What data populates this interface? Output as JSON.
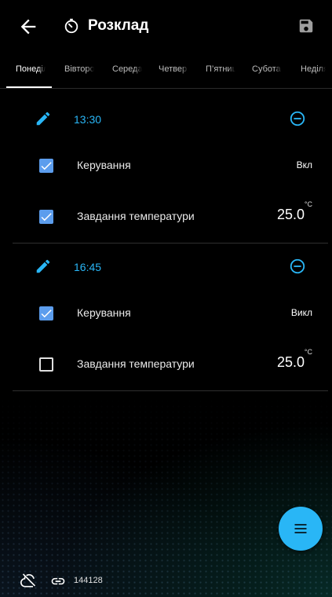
{
  "header": {
    "title": "Розклад"
  },
  "tabs": [
    {
      "label": "Понеділок",
      "active": true
    },
    {
      "label": "Вівторок",
      "active": false
    },
    {
      "label": "Середа",
      "active": false
    },
    {
      "label": "Четвер",
      "active": false
    },
    {
      "label": "П’ятниця",
      "active": false
    },
    {
      "label": "Субота",
      "active": false
    },
    {
      "label": "Неділя",
      "active": false
    }
  ],
  "schedules": [
    {
      "time": "13:30",
      "rows": [
        {
          "label": "Керування",
          "checked": true,
          "value": "Вкл"
        },
        {
          "label": "Завдання температури",
          "checked": true,
          "value": "25.0",
          "unit": "°C"
        }
      ]
    },
    {
      "time": "16:45",
      "rows": [
        {
          "label": "Керування",
          "checked": true,
          "value": "Викл"
        },
        {
          "label": "Завдання температури",
          "checked": false,
          "value": "25.0",
          "unit": "°C"
        }
      ]
    }
  ],
  "footer": {
    "device_id": "144128"
  },
  "colors": {
    "accent": "#29b6f6",
    "checkbox": "#5c9ded",
    "background": "#000000"
  },
  "icons": [
    "back-arrow-icon",
    "timer-icon",
    "save-icon",
    "edit-pencil-icon",
    "remove-circle-icon",
    "menu-icon",
    "cloud-off-icon",
    "link-icon"
  ]
}
